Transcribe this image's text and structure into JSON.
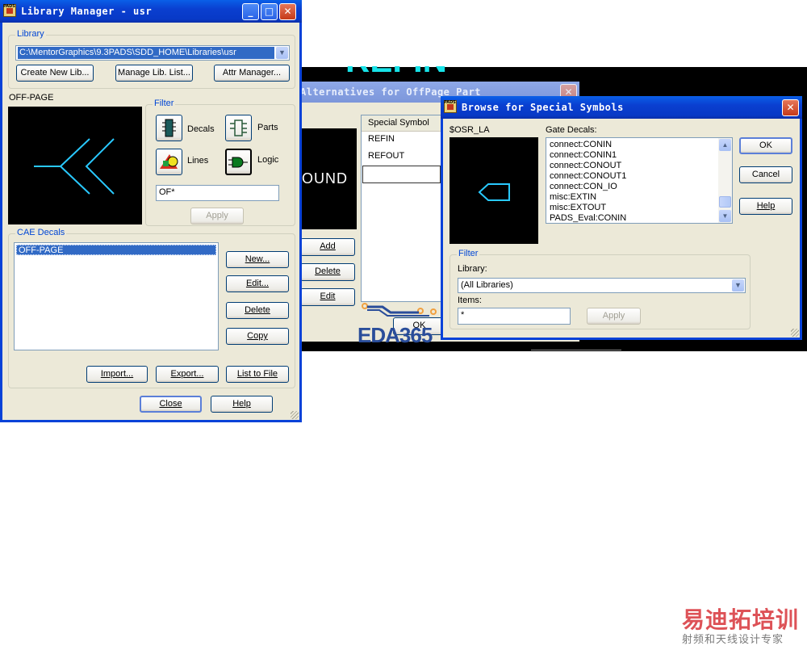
{
  "bg_app": {
    "top_text": "REFIN",
    "round_text": "OUND",
    "eda_logo": "EDA365"
  },
  "libmgr": {
    "title": "Library Manager - usr",
    "minimize": "_",
    "maximize": "□",
    "close": "✕",
    "library_group": "Library",
    "library_path": "C:\\MentorGraphics\\9.3PADS\\SDD_HOME\\Libraries\\usr",
    "create_btn": "Create New Lib...",
    "manage_btn": "Manage Lib. List...",
    "attr_btn": "Attr Manager...",
    "preview_label": "OFF-PAGE",
    "filter_group": "Filter",
    "filter_decals": "Decals",
    "filter_parts": "Parts",
    "filter_lines": "Lines",
    "filter_logic": "Logic",
    "filter_value": "OF*",
    "apply": "Apply",
    "cae_group": "CAE Decals",
    "cae_items": [
      "OFF-PAGE"
    ],
    "new_btn": "New...",
    "edit_btn": "Edit...",
    "delete_btn": "Delete",
    "copy_btn": "Copy",
    "import_btn": "Import...",
    "export_btn": "Export...",
    "list_btn": "List to File",
    "close_btn": "Close",
    "help_btn": "Help"
  },
  "alt": {
    "title": "Alternatives for OffPage Part",
    "col_header": "Special Symbol",
    "rows": [
      "REFIN",
      "REFOUT"
    ],
    "add": "Add",
    "delete": "Delete",
    "edit": "Edit",
    "ok": "OK"
  },
  "browse": {
    "title": "Browse for Special Symbols",
    "symbol_label": "$OSR_LA",
    "gate_label": "Gate Decals:",
    "gate_items": [
      "connect:CONIN",
      "connect:CONIN1",
      "connect:CONOUT",
      "connect:CONOUT1",
      "connect:CON_IO",
      "misc:EXTIN",
      "misc:EXTOUT",
      "PADS_Eval:CONIN"
    ],
    "ok": "OK",
    "cancel": "Cancel",
    "help": "Help",
    "filter_group": "Filter",
    "library_label": "Library:",
    "library_value": "(All Libraries)",
    "items_label": "Items:",
    "items_value": "*",
    "apply": "Apply"
  },
  "watermark": {
    "cn_title": "易迪拓培训",
    "cn_sub": "射频和天线设计专家"
  },
  "colors": {
    "title_blue": "#0a3fd0",
    "xp_face": "#ece9d8",
    "selection": "#316ac5",
    "cyan": "#29c9ff"
  }
}
